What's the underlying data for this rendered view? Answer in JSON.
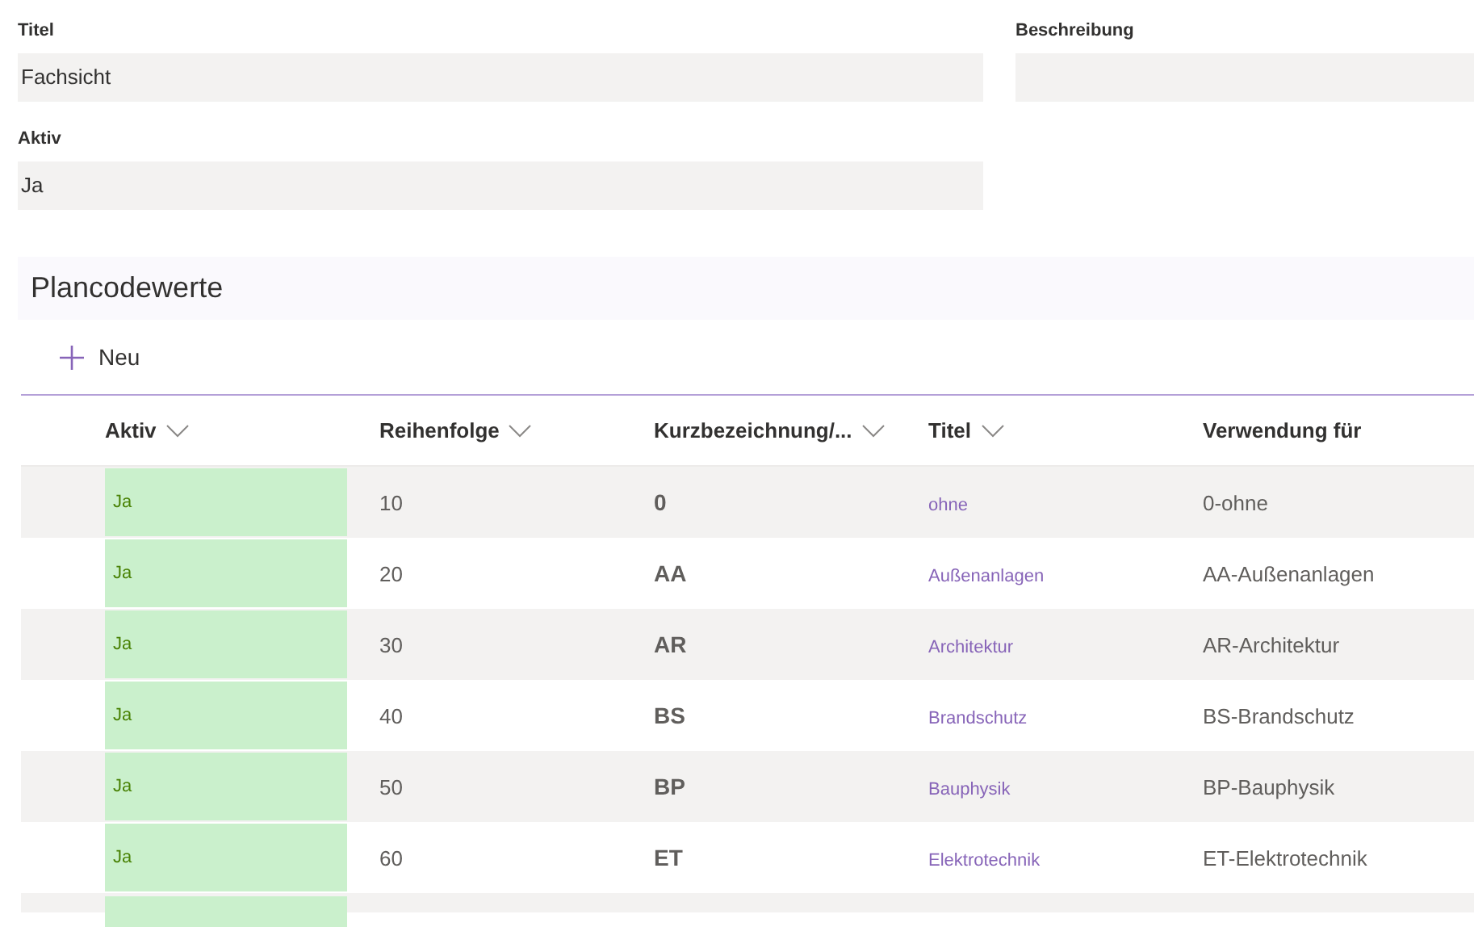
{
  "form": {
    "fields": [
      {
        "label": "Titel",
        "value": "Fachsicht"
      },
      {
        "label": "Aktiv",
        "value": "Ja"
      }
    ],
    "side_fields": [
      {
        "label": "Beschreibung"
      }
    ]
  },
  "section": {
    "title": "Plancodewerte",
    "toolbar": [
      {
        "label": "Neu"
      }
    ]
  },
  "table": {
    "columns": [
      {
        "label": "Aktiv",
        "sortable": true
      },
      {
        "label": "Reihenfolge",
        "sortable": true
      },
      {
        "label": "Kurzbezeichnung/...",
        "sortable": true
      },
      {
        "label": "Titel",
        "sortable": true
      },
      {
        "label": "Verwendung für",
        "sortable": false
      }
    ],
    "rows": [
      {
        "aktiv": "Ja",
        "highlighted": true,
        "order": "10",
        "code": "0",
        "title": "ohne",
        "usage": "0-ohne"
      },
      {
        "aktiv": "Ja",
        "highlighted": true,
        "order": "20",
        "code": "AA",
        "title": "Außenanlagen",
        "usage": "AA-Außenanlagen"
      },
      {
        "aktiv": "Ja",
        "highlighted": true,
        "order": "30",
        "code": "AR",
        "title": "Architektur",
        "usage": "AR-Architektur"
      },
      {
        "aktiv": "Ja",
        "highlighted": true,
        "order": "40",
        "code": "BS",
        "title": "Brandschutz",
        "usage": "BS-Brandschutz"
      },
      {
        "aktiv": "Ja",
        "highlighted": true,
        "order": "50",
        "code": "BP",
        "title": "Bauphysik",
        "usage": "BP-Bauphysik"
      },
      {
        "aktiv": "Ja",
        "highlighted": true,
        "order": "60",
        "code": "ET",
        "title": "Elektrotechnik",
        "usage": "ET-Elektrotechnik"
      }
    ]
  }
}
